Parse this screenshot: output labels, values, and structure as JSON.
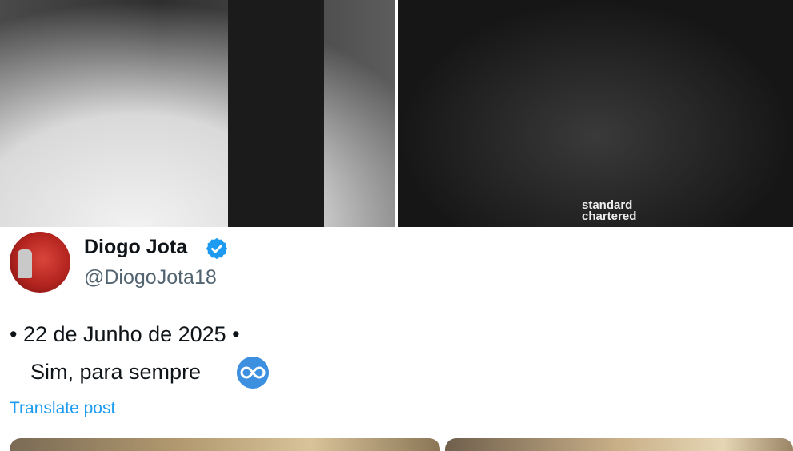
{
  "photos": {
    "left_alt_icon": "wedding-photo",
    "right_alt_icon": "football-celebration-photo",
    "jersey_sponsor": "standard\nchartered"
  },
  "post": {
    "display_name": "Diogo Jota",
    "handle": "@DiogoJota18",
    "verified_icon": "verified-badge-icon",
    "line1": "• 22 de Junho de 2025 •",
    "line2": "Sim, para sempre",
    "emoji_icon": "infinity-emoji-icon",
    "translate_label": "Translate post"
  },
  "colors": {
    "accent": "#1d9bf0",
    "text": "#0f1419",
    "secondary_text": "#536471"
  }
}
